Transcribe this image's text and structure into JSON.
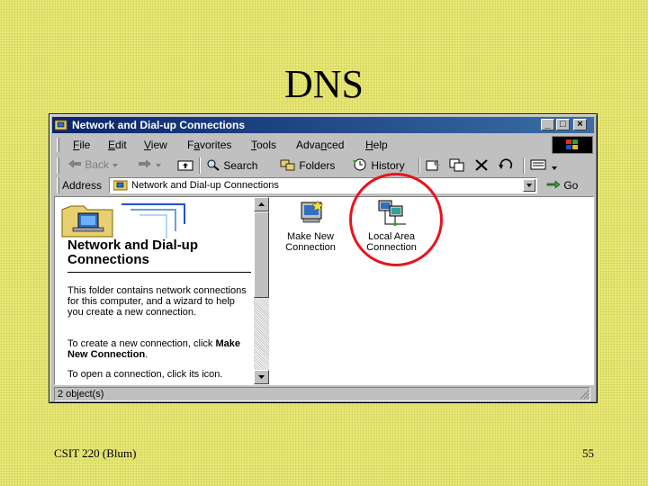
{
  "slide": {
    "title": "DNS",
    "footer_left": "CSIT 220 (Blum)",
    "footer_right": "55"
  },
  "window": {
    "title": "Network and Dial-up Connections",
    "controls": {
      "minimize": "_",
      "maximize": "□",
      "close": "×"
    }
  },
  "menubar": [
    {
      "pre": "",
      "ul": "F",
      "post": "ile"
    },
    {
      "pre": "",
      "ul": "E",
      "post": "dit"
    },
    {
      "pre": "",
      "ul": "V",
      "post": "iew"
    },
    {
      "pre": "F",
      "ul": "a",
      "post": "vorites"
    },
    {
      "pre": "",
      "ul": "T",
      "post": "ools"
    },
    {
      "pre": "Adva",
      "ul": "n",
      "post": "ced"
    },
    {
      "pre": "",
      "ul": "H",
      "post": "elp"
    }
  ],
  "toolbar": {
    "back": "Back",
    "search": "Search",
    "folders": "Folders",
    "history": "History"
  },
  "addressbar": {
    "label": "Address",
    "value": "Network and Dial-up Connections",
    "go": "Go"
  },
  "leftpane": {
    "title": "Network and Dial-up Connections",
    "description": "This folder contains network connections for this computer, and a wizard to help you create a new connection.",
    "create_prefix": "To create a new connection, click",
    "create_bold": "Make New Connection",
    "create_suffix": ".",
    "open_text": "To open a connection, click its icon."
  },
  "icons": [
    {
      "label": "Make New Connection",
      "icon": "make-new-connection-icon"
    },
    {
      "label": "Local Area Connection",
      "icon": "local-area-connection-icon"
    }
  ],
  "statusbar": {
    "text": "2 object(s)"
  },
  "colors": {
    "slide_background": "#e8e87a",
    "titlebar_start": "#0a246a",
    "titlebar_end": "#3a6ea5",
    "highlight": "#e8141c"
  }
}
